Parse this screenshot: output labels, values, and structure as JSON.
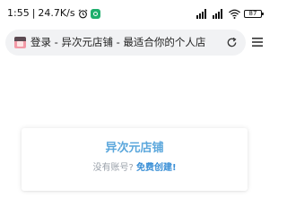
{
  "status_bar": {
    "time": "1:55",
    "network_speed": "24.7K/s",
    "battery_level": "87"
  },
  "browser": {
    "page_title": "登录 - 异次元店铺 - 最适合你的个人店"
  },
  "login_card": {
    "site_name": "异次元店铺",
    "signup_prompt": "没有账号?",
    "signup_link": "免费创建!"
  },
  "colors": {
    "accent": "#5ba7dc",
    "link": "#3a8fd6",
    "muted_text": "#9aa1aa",
    "app_icon": "#1fae6c"
  }
}
